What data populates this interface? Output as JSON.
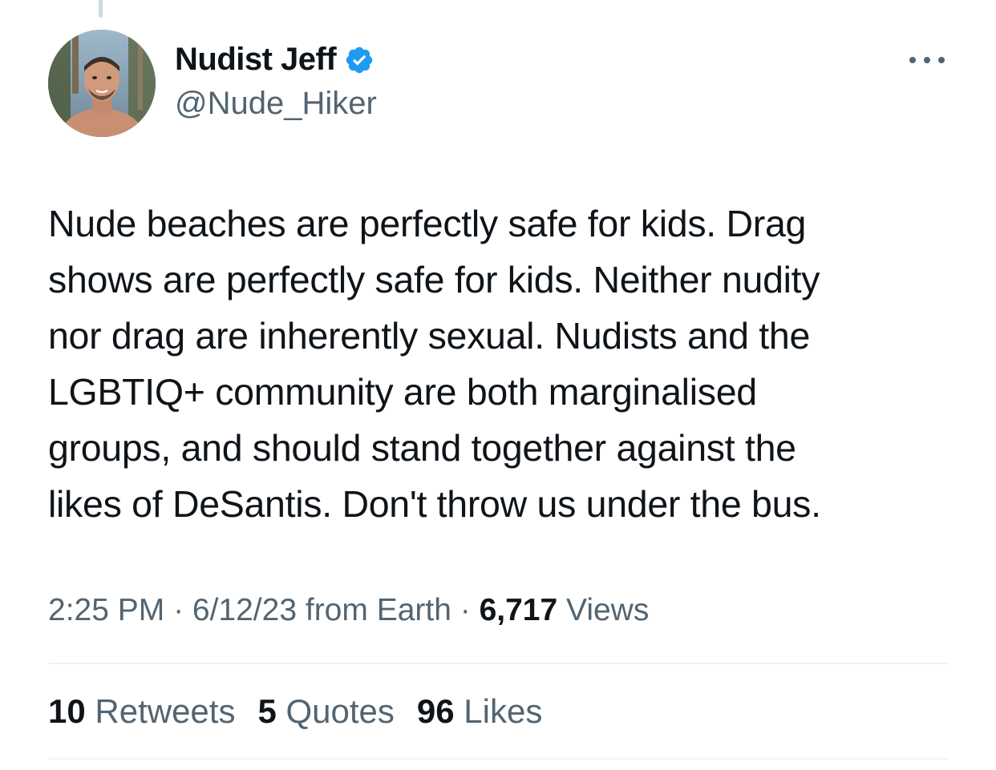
{
  "tweet": {
    "author": {
      "display_name": "Nudist Jeff",
      "handle": "@Nude_Hiker",
      "verified": true
    },
    "text": "Nude beaches are perfectly safe for kids. Drag\nshows are perfectly safe for kids. Neither nudity\nnor drag are inherently sexual. Nudists and the\nLGBTIQ+ community are both marginalised\ngroups, and should stand together against the\nlikes of DeSantis. Don't throw us under the bus.",
    "meta": {
      "time_date_source": "2:25 PM · 6/12/23 from Earth · ",
      "views_count": "6,717",
      "views_label": " Views"
    },
    "stats": {
      "retweets_count": "10",
      "retweets_label": " Retweets",
      "quotes_count": "5",
      "quotes_label": " Quotes",
      "likes_count": "96",
      "likes_label": " Likes"
    }
  },
  "icons": {
    "verified": "verified-badge-icon",
    "more": "more-options-icon"
  },
  "colors": {
    "verified_blue": "#1d9bf0",
    "text_primary": "#0f1419",
    "text_secondary": "#536471",
    "divider": "#eff3f4"
  }
}
